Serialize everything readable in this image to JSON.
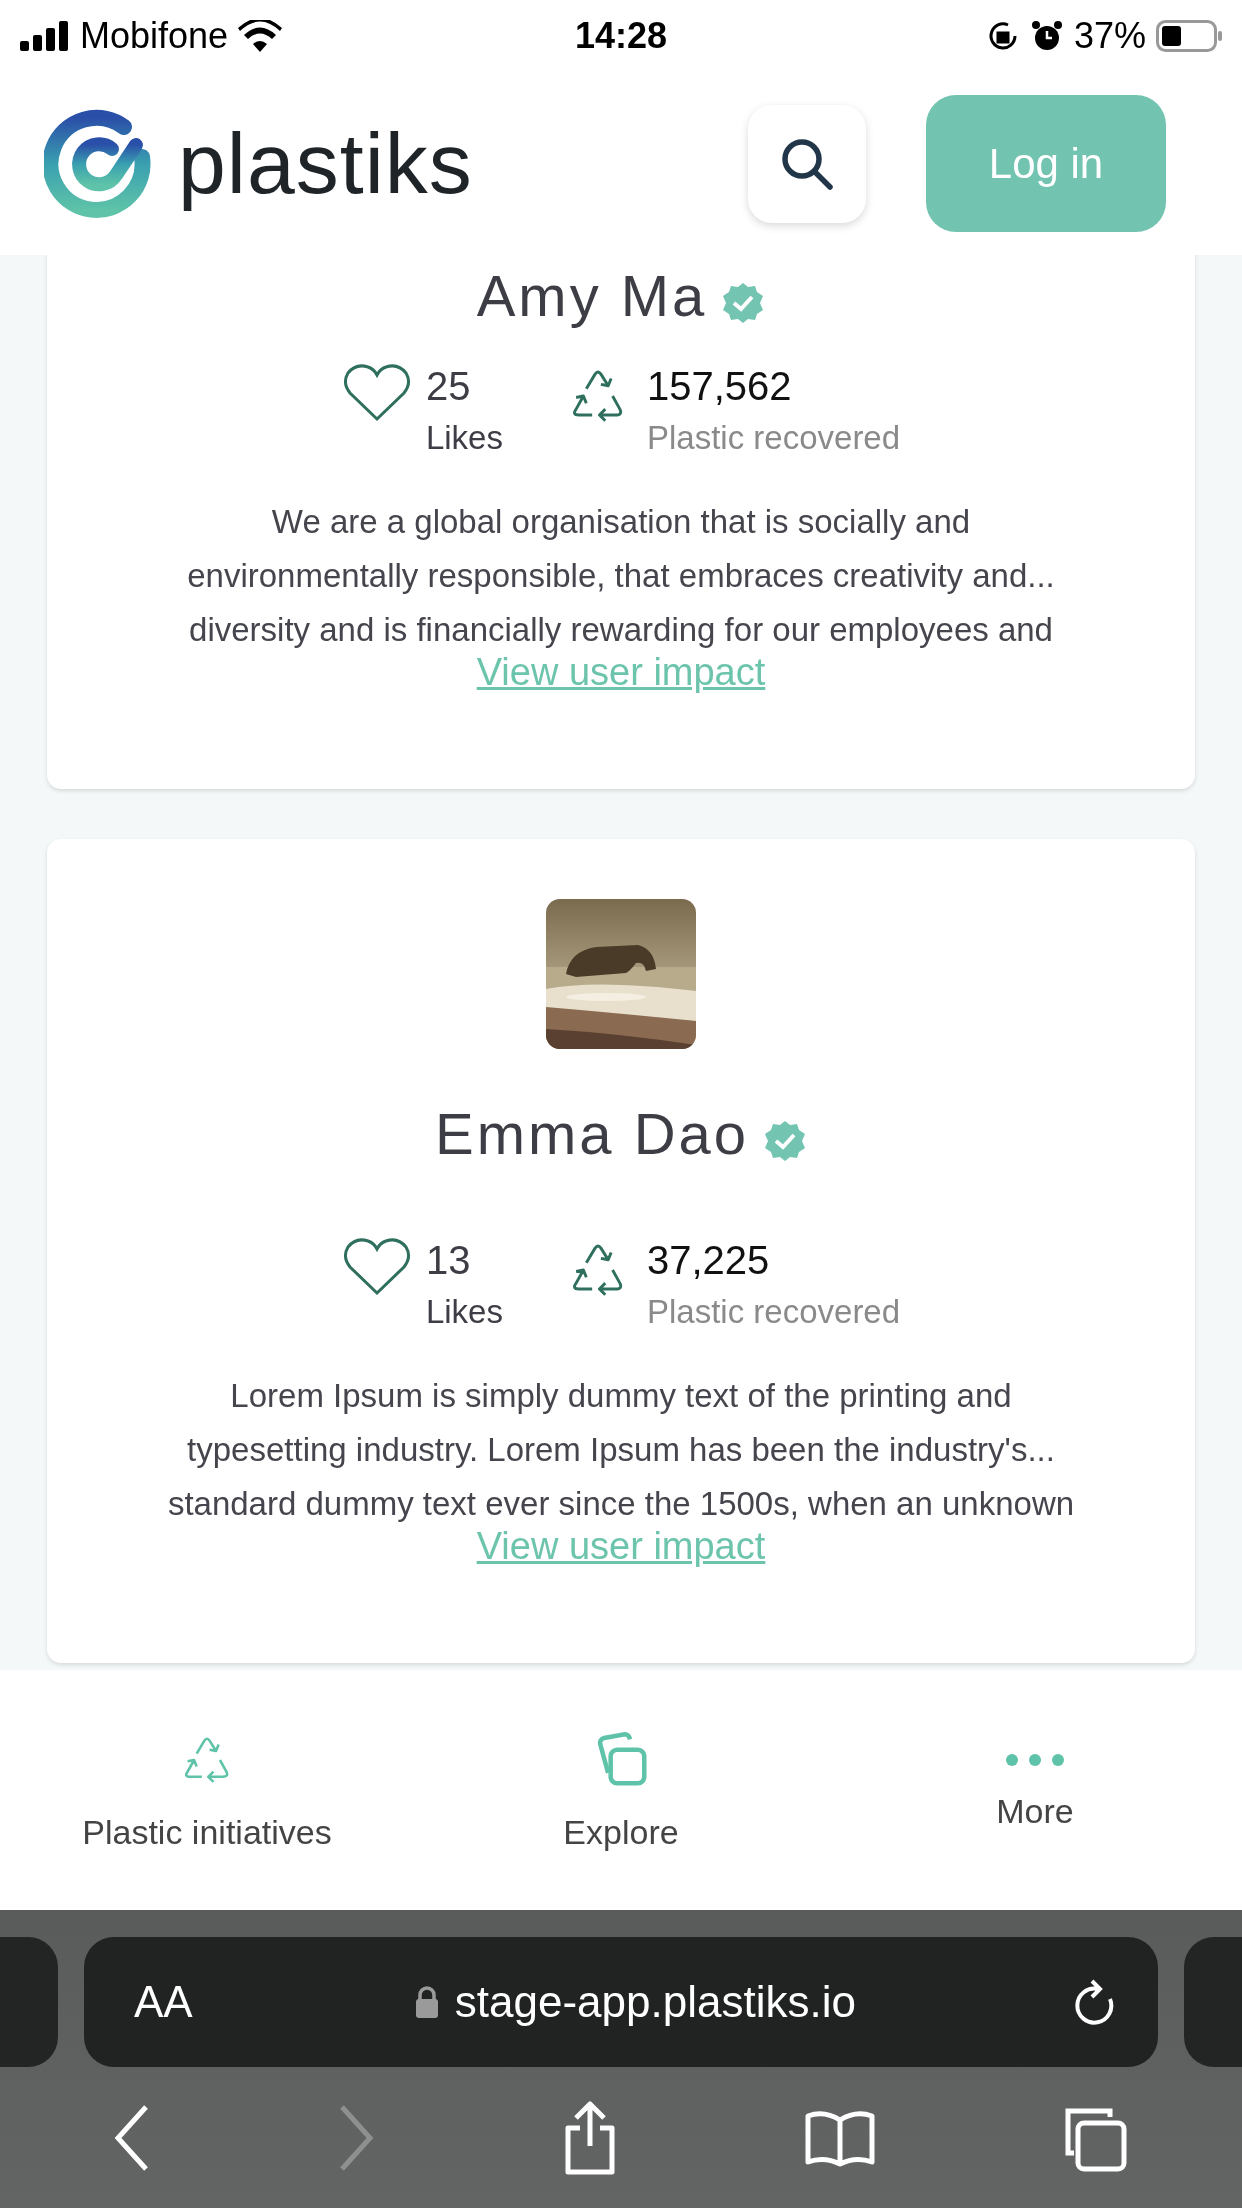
{
  "status_bar": {
    "carrier": "Mobifone",
    "time": "14:28",
    "battery": "37%"
  },
  "header": {
    "logo_text": "plastiks",
    "login_button": "Log in"
  },
  "cards": [
    {
      "name": "Amy Ma",
      "verified": true,
      "likes": "25",
      "likes_label": "Likes",
      "plastic": "157,562",
      "plastic_label": "Plastic recovered",
      "description_lines": [
        "We are a global organisation that is socially and",
        "environmentally responsible, that embraces creativity and...",
        "diversity and is financially rewarding for our employees and"
      ],
      "link": "View user impact"
    },
    {
      "name": "Emma Dao",
      "verified": true,
      "likes": "13",
      "likes_label": "Likes",
      "plastic": "37,225",
      "plastic_label": "Plastic recovered",
      "description_lines": [
        "Lorem Ipsum is simply dummy text of the printing and",
        "typesetting industry. Lorem Ipsum has been the industry's...",
        "standard dummy text ever since the 1500s, when an unknown"
      ],
      "link": "View user impact"
    }
  ],
  "bottom_nav": [
    {
      "kind": "recycle",
      "label": "Plastic initiatives"
    },
    {
      "kind": "squares",
      "label": "Explore"
    },
    {
      "kind": "dots",
      "label": "More"
    }
  ],
  "browser": {
    "text_size_button": "AA",
    "url": "stage-app.plastiks.io",
    "toolbar": [
      {
        "kind": "back",
        "disabled": false
      },
      {
        "kind": "forward",
        "disabled": true
      },
      {
        "kind": "share",
        "disabled": false
      },
      {
        "kind": "bookmarks",
        "disabled": false
      },
      {
        "kind": "tabs",
        "disabled": false
      }
    ]
  }
}
